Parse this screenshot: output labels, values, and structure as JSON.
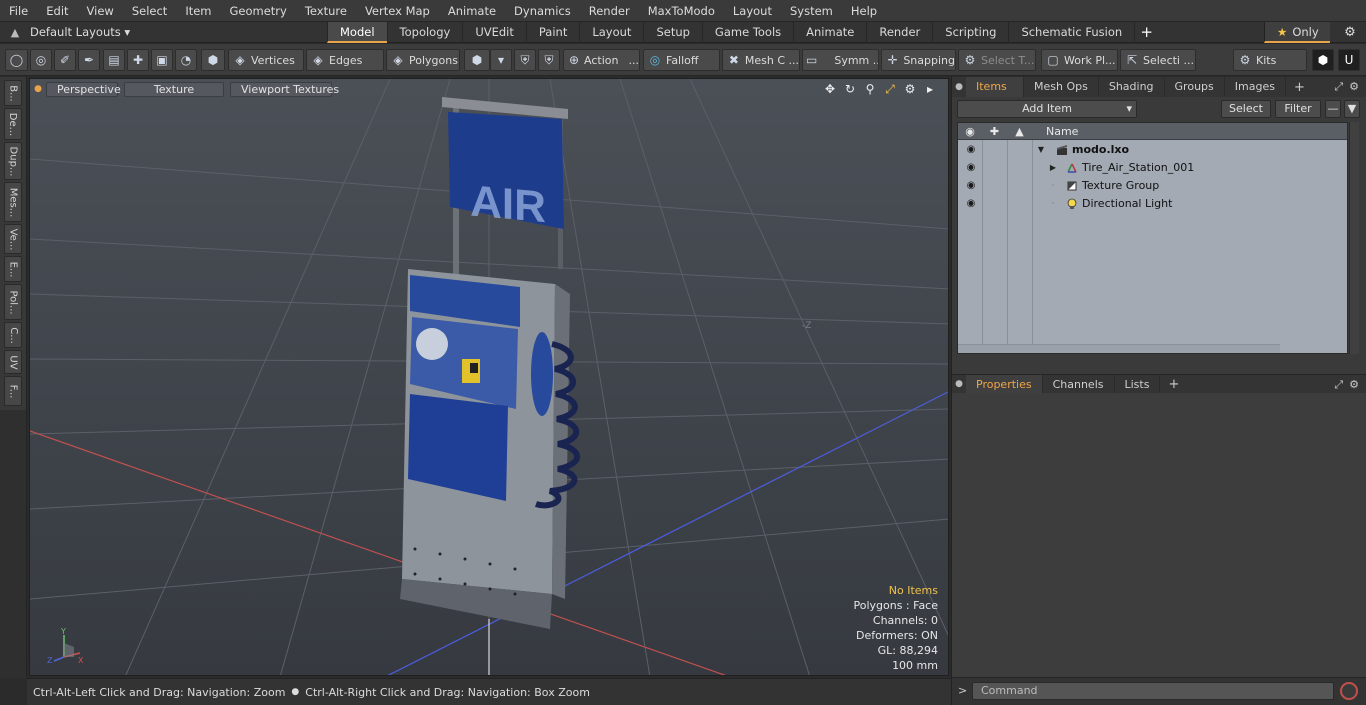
{
  "menu": [
    "File",
    "Edit",
    "View",
    "Select",
    "Item",
    "Geometry",
    "Texture",
    "Vertex Map",
    "Animate",
    "Dynamics",
    "Render",
    "MaxToModo",
    "Layout",
    "System",
    "Help"
  ],
  "layouts": {
    "label": "Default Layouts ▾"
  },
  "tabs": [
    "Model",
    "Topology",
    "UVEdit",
    "Paint",
    "Layout",
    "Setup",
    "Game Tools",
    "Animate",
    "Render",
    "Scripting",
    "Schematic Fusion"
  ],
  "active_tab": "Model",
  "only": {
    "label": "Only"
  },
  "toolbar": {
    "vertices": "Vertices",
    "edges": "Edges",
    "polygons": "Polygons",
    "action": "Action",
    "falloff": "Falloff",
    "mesh": "Mesh C ...",
    "symm": "Symm ...",
    "snapping": "Snapping",
    "select_t": "Select T...",
    "work_pl": "Work Pl...",
    "selecti": "Selecti ...",
    "kits": "Kits",
    "action_more": "..."
  },
  "left_strip": [
    "B...",
    "De...",
    "Dup...",
    "Mes...",
    "Ve...",
    "E...",
    "Pol...",
    "C...",
    "UV",
    "F..."
  ],
  "viewport": {
    "perspective": "Perspective",
    "texture": "Texture",
    "viewport_textures": "Viewport Textures",
    "sign_text": "AIR",
    "info": {
      "no_items": "No Items",
      "polygons": "Polygons : Face",
      "channels": "Channels: 0",
      "deformers": "Deformers: ON",
      "gl": "GL: 88,294",
      "scale": "100 mm"
    },
    "axis_labels": {
      "y": "Y",
      "x": "X",
      "z": "Z"
    }
  },
  "status": {
    "left": "Ctrl-Alt-Left Click and Drag: Navigation: Zoom",
    "right": "Ctrl-Alt-Right Click and Drag: Navigation: Box Zoom"
  },
  "items_panel": {
    "tabs": [
      "Items",
      "Mesh Ops",
      "Shading",
      "Groups",
      "Images"
    ],
    "active": "Items",
    "add_item": "Add Item",
    "select": "Select",
    "filter": "Filter",
    "column_name": "Name",
    "tree": [
      {
        "label": "modo.lxo",
        "bold": true,
        "indent": 0
      },
      {
        "label": "Tire_Air_Station_001",
        "bold": false,
        "indent": 1
      },
      {
        "label": "Texture Group",
        "bold": false,
        "indent": 1
      },
      {
        "label": "Directional Light",
        "bold": false,
        "indent": 1
      }
    ]
  },
  "properties_panel": {
    "tabs": [
      "Properties",
      "Channels",
      "Lists"
    ],
    "active": "Properties"
  },
  "command": {
    "placeholder": "Command",
    "prompt": ">"
  },
  "colors": {
    "accent": "#e8a44a",
    "tree_bg": "#a3aab3",
    "viewport_bg": "#454a51"
  }
}
